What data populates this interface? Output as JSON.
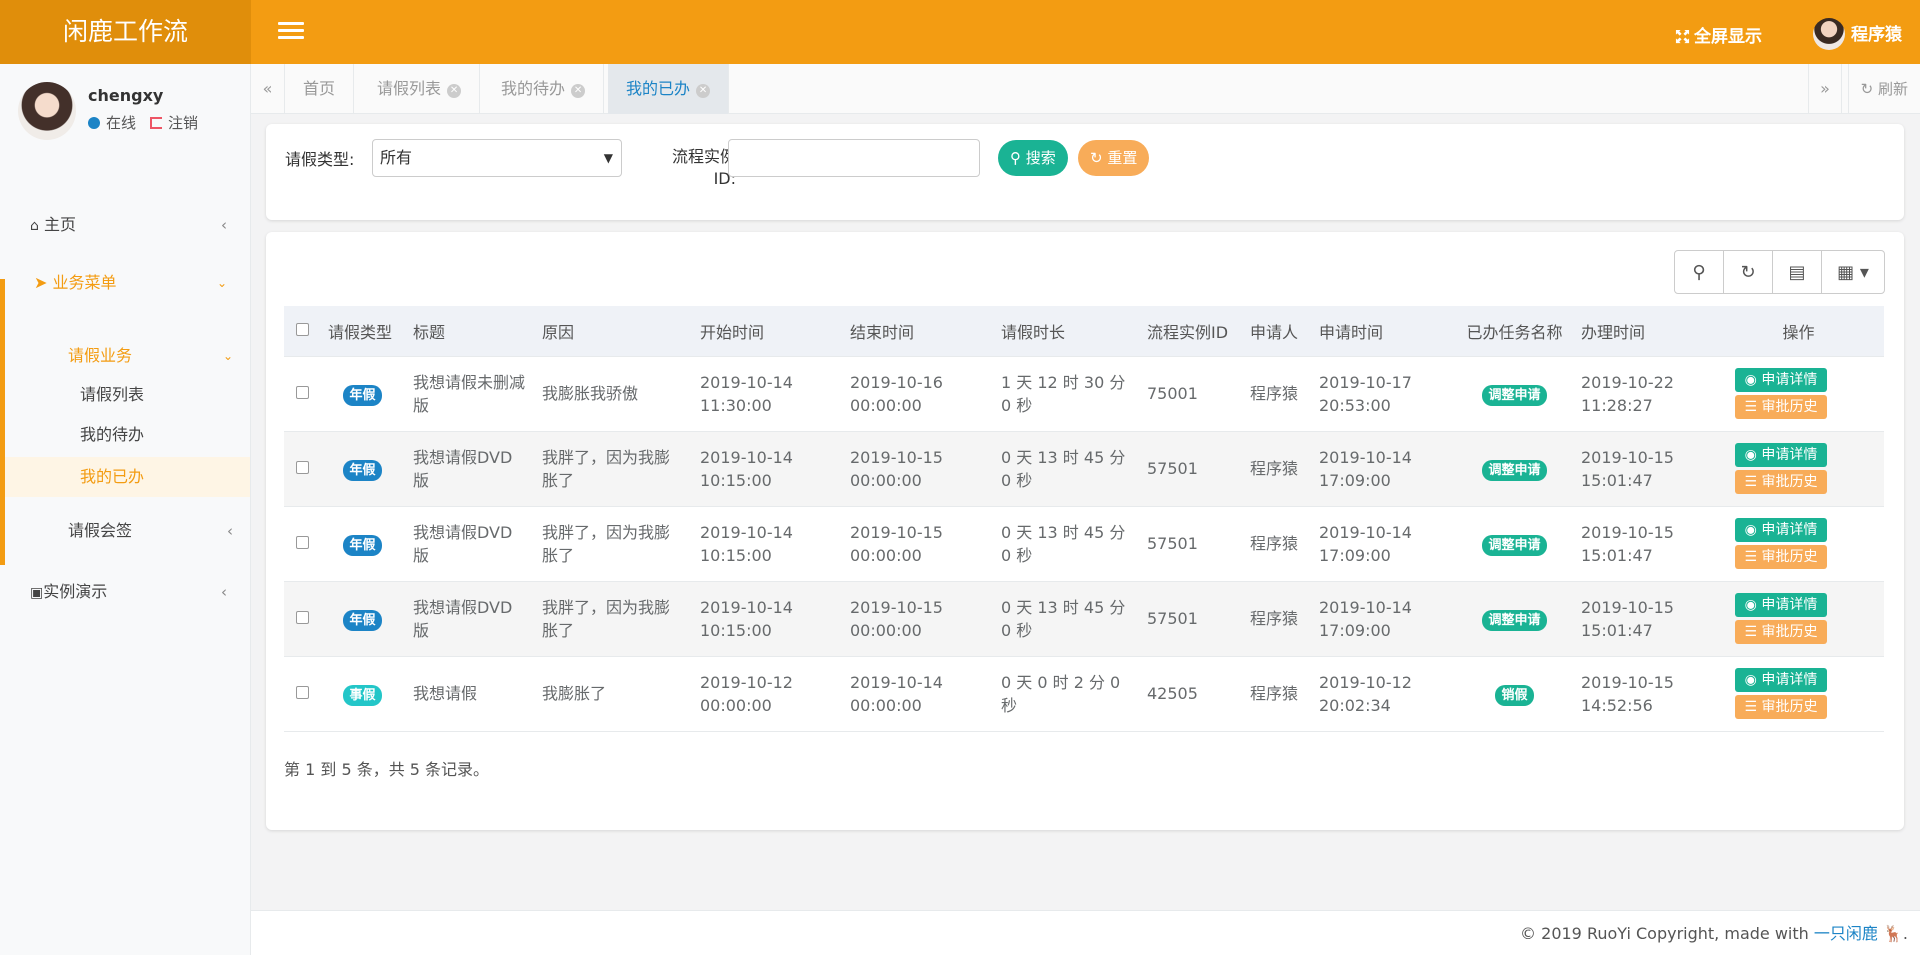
{
  "app": {
    "brand": "闲鹿工作流",
    "fullscreen_label": "全屏显示",
    "top_user": "程序猿"
  },
  "profile": {
    "username": "chengxy",
    "status": "在线",
    "logout": "注销"
  },
  "sidebar": {
    "home": "主页",
    "business_menu": "业务菜单",
    "leave_business": "请假业务",
    "leave_list": "请假列表",
    "my_todo": "我的待办",
    "my_done": "我的已办",
    "leave_countersign": "请假会签",
    "demo": "实例演示"
  },
  "tabs": {
    "home": "首页",
    "leave_list": "请假列表",
    "my_todo": "我的待办",
    "my_done": "我的已办",
    "refresh": "刷新"
  },
  "search": {
    "type_label": "请假类型:",
    "type_value": "所有",
    "instance_label": "流程实例ID:",
    "instance_value": "",
    "search_btn": "搜索",
    "reset_btn": "重置"
  },
  "table": {
    "headers": [
      "请假类型",
      "标题",
      "原因",
      "开始时间",
      "结束时间",
      "请假时长",
      "流程实例ID",
      "申请人",
      "申请时间",
      "已办任务名称",
      "办理时间",
      "操作"
    ],
    "rows": [
      {
        "type": "年假",
        "type_color": "blue",
        "title": "我想请假未删减版",
        "reason": "我膨胀我骄傲",
        "start": "2019-10-14 11:30:00",
        "end": "2019-10-16 00:00:00",
        "duration": "1 天 12 时 30 分 0 秒",
        "instance_id": "75001",
        "applicant": "程序猿",
        "apply_time": "2019-10-17 20:53:00",
        "task": "调整申请",
        "handle_time": "2019-10-22 11:28:27"
      },
      {
        "type": "年假",
        "type_color": "blue",
        "title": "我想请假DVD版",
        "reason": "我胖了，因为我膨胀了",
        "start": "2019-10-14 10:15:00",
        "end": "2019-10-15 00:00:00",
        "duration": "0 天 13 时 45 分 0 秒",
        "instance_id": "57501",
        "applicant": "程序猿",
        "apply_time": "2019-10-14 17:09:00",
        "task": "调整申请",
        "handle_time": "2019-10-15 15:01:47"
      },
      {
        "type": "年假",
        "type_color": "blue",
        "title": "我想请假DVD版",
        "reason": "我胖了，因为我膨胀了",
        "start": "2019-10-14 10:15:00",
        "end": "2019-10-15 00:00:00",
        "duration": "0 天 13 时 45 分 0 秒",
        "instance_id": "57501",
        "applicant": "程序猿",
        "apply_time": "2019-10-14 17:09:00",
        "task": "调整申请",
        "handle_time": "2019-10-15 15:01:47"
      },
      {
        "type": "年假",
        "type_color": "blue",
        "title": "我想请假DVD版",
        "reason": "我胖了，因为我膨胀了",
        "start": "2019-10-14 10:15:00",
        "end": "2019-10-15 00:00:00",
        "duration": "0 天 13 时 45 分 0 秒",
        "instance_id": "57501",
        "applicant": "程序猿",
        "apply_time": "2019-10-14 17:09:00",
        "task": "调整申请",
        "handle_time": "2019-10-15 15:01:47"
      },
      {
        "type": "事假",
        "type_color": "teal",
        "title": "我想请假",
        "reason": "我膨胀了",
        "start": "2019-10-12 00:00:00",
        "end": "2019-10-14 00:00:00",
        "duration": "0 天 0 时 2 分 0 秒",
        "instance_id": "42505",
        "applicant": "程序猿",
        "apply_time": "2019-10-12 20:02:34",
        "task": "销假",
        "handle_time": "2019-10-15 14:52:56"
      }
    ],
    "detail_btn": "申请详情",
    "history_btn": "审批历史",
    "page_info": "第 1 到 5 条，共 5 条记录。"
  },
  "footer": {
    "copyright": "© 2019 RuoYi Copyright, made with",
    "link": "一只闲鹿"
  },
  "colors": {
    "header": "#f39c12",
    "brand_bg": "#e08e0b",
    "primary": "#1ab394",
    "warning": "#f8ac59",
    "info": "#1c84c6"
  }
}
